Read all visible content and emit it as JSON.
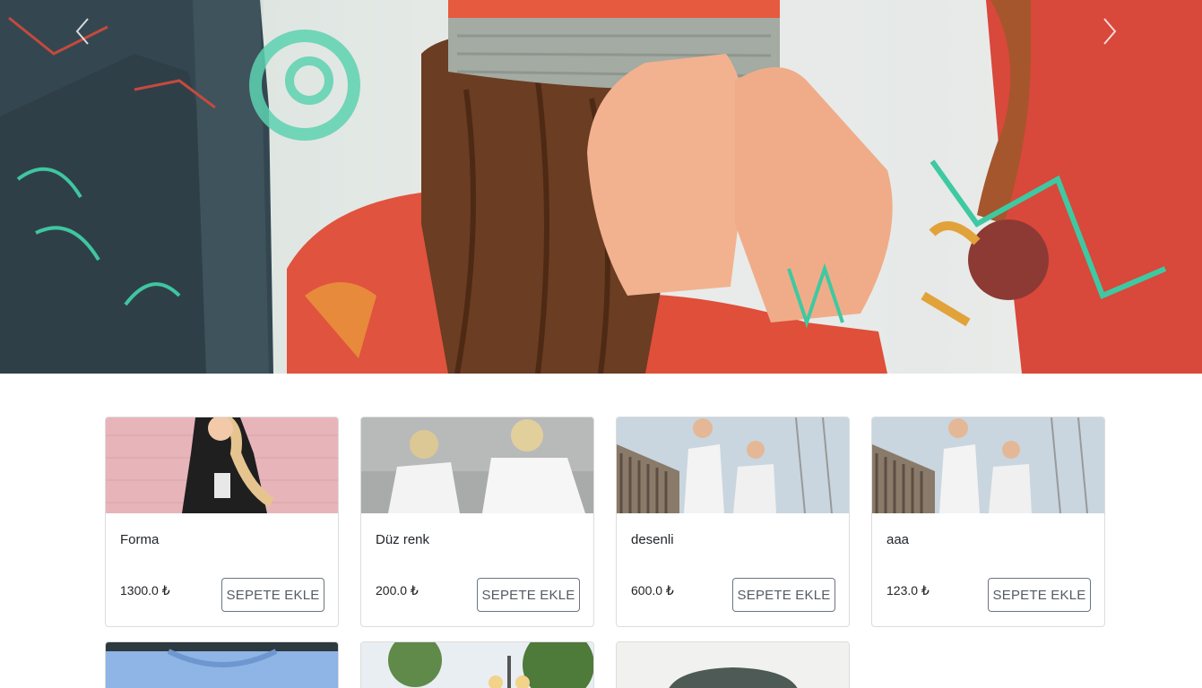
{
  "carousel": {
    "prev_icon": "chevron-left-icon",
    "next_icon": "chevron-right-icon"
  },
  "products": [
    {
      "name": "Forma",
      "price": "1300.0 ₺",
      "button": "SEPETE EKLE",
      "photo": "woman-black-skeleton-tee"
    },
    {
      "name": "Düz renk",
      "price": "200.0 ₺",
      "button": "SEPETE EKLE",
      "photo": "two-people-white-tees"
    },
    {
      "name": "desenli",
      "price": "600.0 ₺",
      "button": "SEPETE EKLE",
      "photo": "couple-1990-1995-tees"
    },
    {
      "name": "aaa",
      "price": "123.0 ₺",
      "button": "SEPETE EKLE",
      "photo": "couple-1990-1995-tees"
    }
  ],
  "products_partial": [
    {
      "photo": "blue-tshirt"
    },
    {
      "photo": "street-lamp-trees"
    },
    {
      "photo": "grey-beanie"
    }
  ],
  "colors": {
    "card_border": "#dcdcdc",
    "button_border": "#6c757d",
    "text": "#212529"
  }
}
